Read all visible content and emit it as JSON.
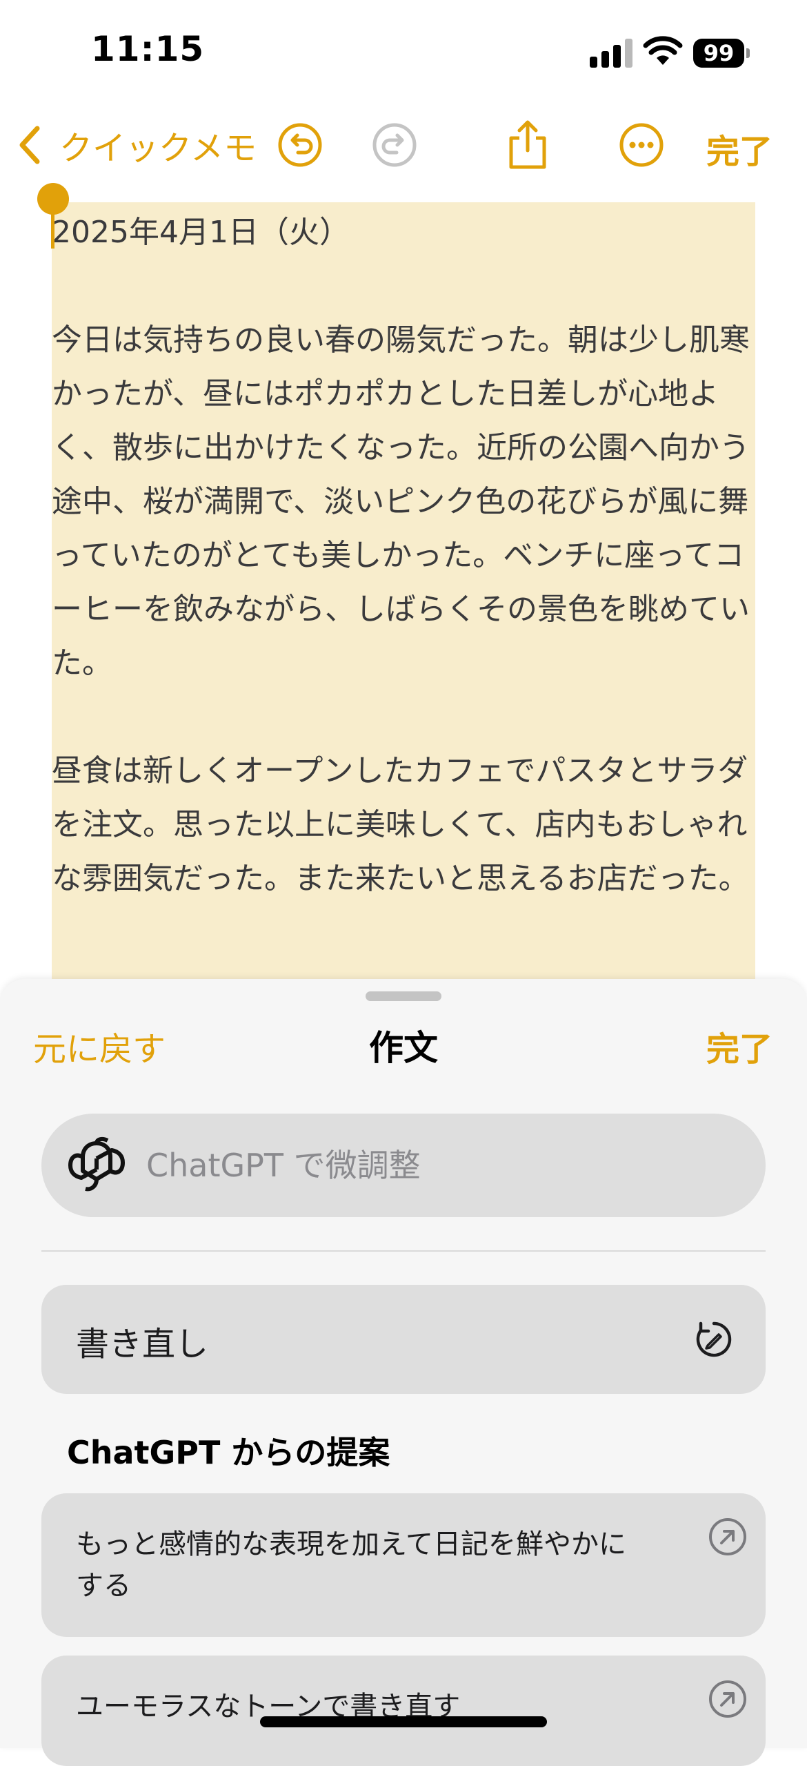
{
  "status_bar": {
    "time": "11:15",
    "battery": "99"
  },
  "nav": {
    "back_label": "クイックメモ",
    "done_label": "完了",
    "accent_color": "#e1a10a"
  },
  "note": {
    "date": "2025年4月1日（火）",
    "paragraph1": "今日は気持ちの良い春の陽気だった。朝は少し肌寒かったが、昼にはポカポカとした日差しが心地よく、散歩に出かけたくなった。近所の公園へ向かう途中、桜が満開で、淡いピンク色の花びらが風に舞っていたのがとても美しかった。ベンチに座ってコーヒーを飲みながら、しばらくその景色を眺めていた。",
    "paragraph2": "昼食は新しくオープンしたカフェでパスタとサラダを注文。思った以上に美味しくて、店内もおしゃれな雰囲気だった。また来たいと思えるお店だった。",
    "highlight_color": "#f8edcc"
  },
  "sheet": {
    "cancel_label": "元に戻す",
    "title": "作文",
    "done_label": "完了",
    "gpt_placeholder": "ChatGPT で微調整",
    "rewrite_label": "書き直し",
    "suggestions_title": "ChatGPT からの提案",
    "suggestions": [
      {
        "label": "もっと感情的な表現を加えて日記を鮮やかにする"
      },
      {
        "label": "ユーモラスなトーンで書き直す"
      }
    ]
  }
}
